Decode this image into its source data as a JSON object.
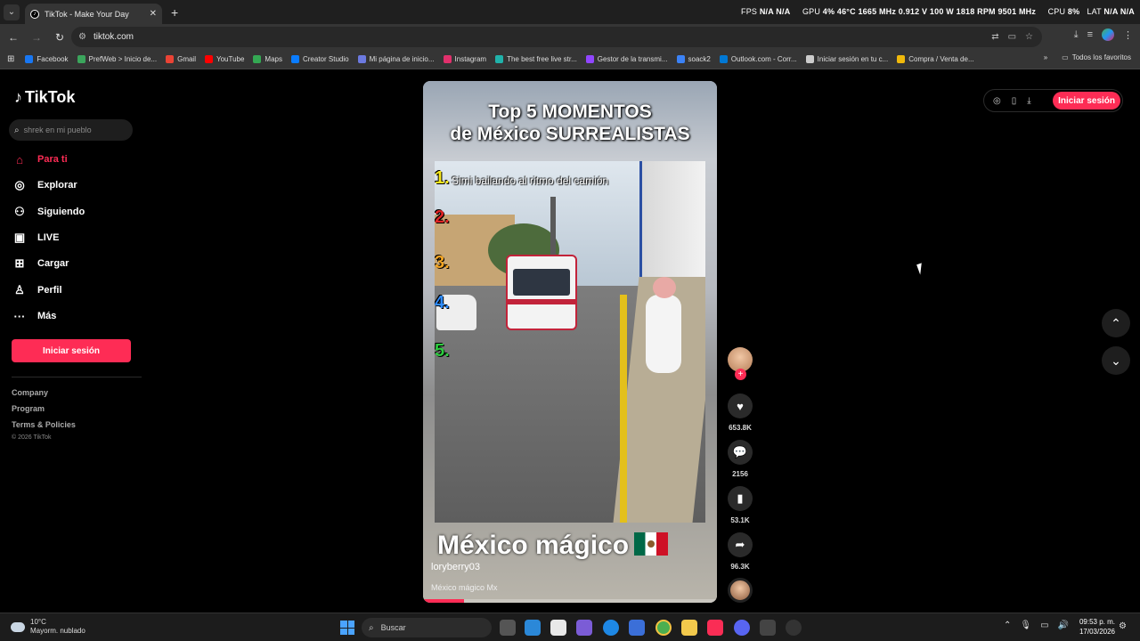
{
  "browser": {
    "tab_title": "TikTok - Make Your Day",
    "url": "tiktok.com",
    "overlay": {
      "fps_label": "FPS",
      "fps_values": "N/A  N/A",
      "gpu_label": "GPU",
      "gpu_values": "4%  46°C  1665 MHz  0.912 V  100 W  1818 RPM  9501 MHz",
      "cpu_label": "CPU",
      "cpu_value": "8%",
      "lat_label": "LAT",
      "lat_values": "N/A  N/A"
    },
    "bookmarks": [
      {
        "label": "Facebook",
        "color": "#1877f2"
      },
      {
        "label": "PrefWeb > Inicio de...",
        "color": "#3ba55c"
      },
      {
        "label": "Gmail",
        "color": "#ea4335"
      },
      {
        "label": "YouTube",
        "color": "#ff0000"
      },
      {
        "label": "Maps",
        "color": "#34a853"
      },
      {
        "label": "Creator Studio",
        "color": "#0a7cff"
      },
      {
        "label": "Mi página de inicio...",
        "color": "#6c7ae0"
      },
      {
        "label": "Instagram",
        "color": "#e1306c"
      },
      {
        "label": "The best free live str...",
        "color": "#20b2aa"
      },
      {
        "label": "Gestor de la transmi...",
        "color": "#9146ff"
      },
      {
        "label": "soack2",
        "color": "#3b82f6"
      },
      {
        "label": "Outlook.com - Corr...",
        "color": "#0078d4"
      },
      {
        "label": "Iniciar sesión en tu c...",
        "color": "#cccccc"
      },
      {
        "label": "Compra / Venta de...",
        "color": "#f0b90b"
      }
    ],
    "bookmarks_more": "»",
    "all_favorites": "Todos los favoritos"
  },
  "tiktok": {
    "logo": "TikTok",
    "search_placeholder": "shrek en mi pueblo",
    "menu": [
      {
        "label": "Para ti",
        "icon": "home-icon",
        "glyph": "⌂"
      },
      {
        "label": "Explorar",
        "icon": "compass-icon",
        "glyph": "◎"
      },
      {
        "label": "Siguiendo",
        "icon": "following-icon",
        "glyph": "⚇"
      },
      {
        "label": "LIVE",
        "icon": "live-tv-icon",
        "glyph": "▣"
      },
      {
        "label": "Cargar",
        "icon": "upload-icon",
        "glyph": "⊞"
      },
      {
        "label": "Perfil",
        "icon": "profile-icon",
        "glyph": "♙"
      },
      {
        "label": "Más",
        "icon": "more-icon",
        "glyph": "···"
      }
    ],
    "login_button": "Iniciar sesión",
    "footer_links": [
      "Company",
      "Program",
      "Terms & Policies"
    ],
    "copyright": "© 2026 TikTok",
    "top_login": "Iniciar sesión",
    "accent": "#fe2c55"
  },
  "video": {
    "title_line1": "Top 5 MOMENTOS",
    "title_line2": "de México SURREALISTAS",
    "partial_caption": "...",
    "item1_caption": "Simi bailando al ritmo del camión",
    "ranks": [
      {
        "label": "1.",
        "color": "#f7e71c"
      },
      {
        "label": "2.",
        "color": "#e02424"
      },
      {
        "label": "3.",
        "color": "#f5a623"
      },
      {
        "label": "4.",
        "color": "#2f8cff"
      },
      {
        "label": "5.",
        "color": "#2ecc40"
      }
    ],
    "bottom_text": "México mágico",
    "username": "loryberry03",
    "description": "México mágico Mx",
    "progress_fraction": 0.14
  },
  "actions": {
    "likes": "653.8K",
    "comments": "2156",
    "saves": "53.1K",
    "shares": "96.3K"
  },
  "taskbar": {
    "temp": "10°C",
    "weather": "Mayorm. nublado",
    "search": "Buscar",
    "time": "09:53 p. m.",
    "date": "17/03/2026"
  }
}
